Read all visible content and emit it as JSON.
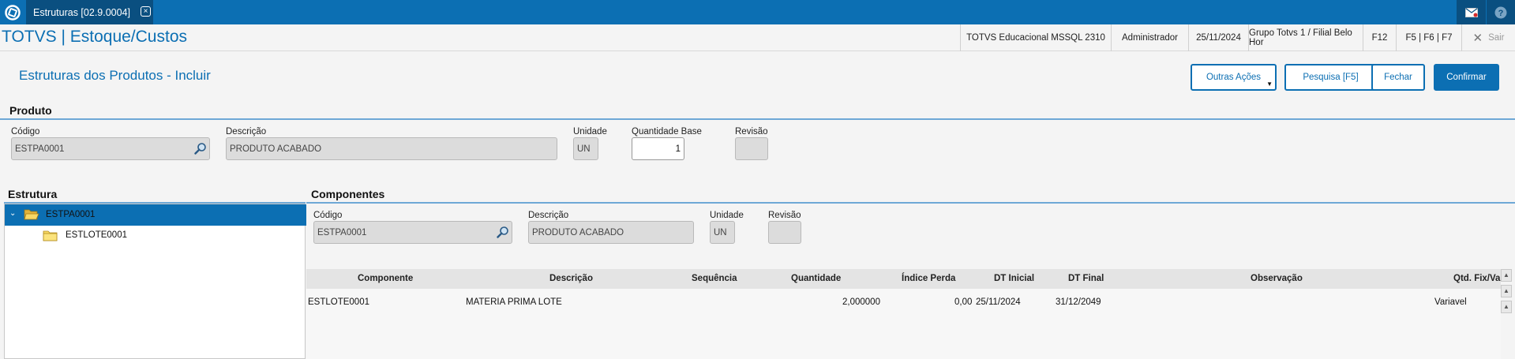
{
  "topbar": {
    "tab_label": "Estruturas [02.9.0004]"
  },
  "header": {
    "app_title": "TOTVS | Estoque/Custos",
    "environment": "TOTVS Educacional MSSQL 2310",
    "user": "Administrador",
    "date": "25/11/2024",
    "branch": "Grupo Totvs 1 / Filial Belo Hor",
    "f12": "F12",
    "shortcuts": "F5 | F6 | F7",
    "exit": "Sair"
  },
  "page": {
    "title": "Estruturas dos Produtos - Incluir"
  },
  "actions": {
    "other": "Outras Ações",
    "search": "Pesquisa [F5]",
    "close": "Fechar",
    "confirm": "Confirmar"
  },
  "produto": {
    "section_title": "Produto",
    "codigo_label": "Código",
    "codigo_value": "ESTPA0001",
    "descricao_label": "Descrição",
    "descricao_value": "PRODUTO ACABADO",
    "unidade_label": "Unidade",
    "unidade_value": "UN",
    "qtd_base_label": "Quantidade Base",
    "qtd_base_value": "1",
    "revisao_label": "Revisão",
    "revisao_value": ""
  },
  "estrutura": {
    "section_title": "Estrutura",
    "root": "ESTPA0001",
    "child": "ESTLOTE0001"
  },
  "componentes": {
    "section_title": "Componentes",
    "codigo_label": "Código",
    "codigo_value": "ESTPA0001",
    "descricao_label": "Descrição",
    "descricao_value": "PRODUTO ACABADO",
    "unidade_label": "Unidade",
    "unidade_value": "UN",
    "revisao_label": "Revisão",
    "revisao_value": ""
  },
  "grid": {
    "headers": [
      "Componente",
      "Descrição",
      "Sequência",
      "Quantidade",
      "Índice Perda",
      "DT Inicial",
      "DT Final",
      "Observação",
      "Qtd. Fix/Va"
    ],
    "rows": [
      [
        "ESTLOTE0001",
        "MATERIA PRIMA LOTE",
        "",
        "2,000000",
        "0,00",
        "25/11/2024",
        "31/12/2049",
        "",
        "Variavel"
      ]
    ]
  },
  "colors": {
    "brand": "#0c6fb3",
    "brand_dark": "#0a4f80"
  }
}
